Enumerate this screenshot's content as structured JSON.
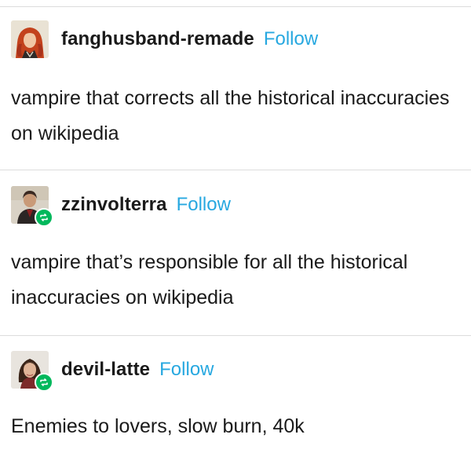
{
  "posts": [
    {
      "username": "fanghusband-remade",
      "follow_label": "Follow",
      "body": "vampire that corrects all the historical inaccuracies on wikipedia",
      "avatar_icon": "avatar-red-hair-icon",
      "reblogged": false
    },
    {
      "username": "zzinvolterra",
      "follow_label": "Follow",
      "body": "vampire that’s responsible for all the historical inaccuracies on wikipedia",
      "avatar_icon": "avatar-dark-figure-icon",
      "reblogged": true
    },
    {
      "username": "devil-latte",
      "follow_label": "Follow",
      "body": "Enemies to lovers, slow burn, 40k",
      "avatar_icon": "avatar-woman-icon",
      "reblogged": true
    }
  ],
  "colors": {
    "follow": "#27a8e0",
    "reblog_badge": "#00b85c",
    "divider": "#dcdcdc",
    "text": "#1a1a1a"
  }
}
